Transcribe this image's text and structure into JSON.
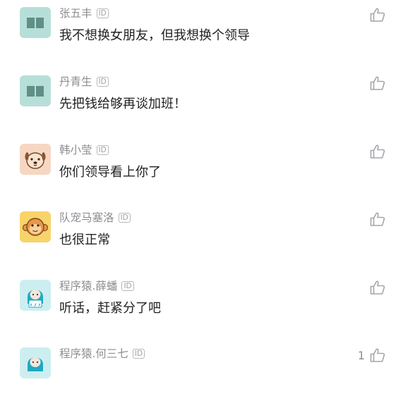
{
  "comments": [
    {
      "username": "张五丰",
      "id_badge": "ID",
      "text": "我不想换女朋友，但我想换个领导",
      "likes": "",
      "avatar": "book-icon"
    },
    {
      "username": "丹青生",
      "id_badge": "ID",
      "text": "先把钱给够再谈加班！",
      "likes": "",
      "avatar": "book-icon"
    },
    {
      "username": "韩小莹",
      "id_badge": "ID",
      "text": "你们领导看上你了",
      "likes": "",
      "avatar": "dog-icon"
    },
    {
      "username": "队宠马塞洛",
      "id_badge": "ID",
      "text": "也很正常",
      "likes": "",
      "avatar": "monkey-icon"
    },
    {
      "username": "程序猿.薛蟠",
      "id_badge": "ID",
      "text": "听话，赶紧分了吧",
      "likes": "",
      "avatar": "programmer-icon"
    },
    {
      "username": "程序猿.何三七",
      "id_badge": "ID",
      "text": "",
      "likes": "1",
      "avatar": "programmer-icon"
    }
  ],
  "colors": {
    "username": "#8e8e93",
    "text": "#222222",
    "book_avatar_bg": "#b7dfd9",
    "book_icon": "#5f8f87",
    "dog_avatar_bg": "#f6d7c3",
    "monkey_avatar_bg": "#f7d36a",
    "programmer_avatar_bg": "#cdeef0"
  }
}
